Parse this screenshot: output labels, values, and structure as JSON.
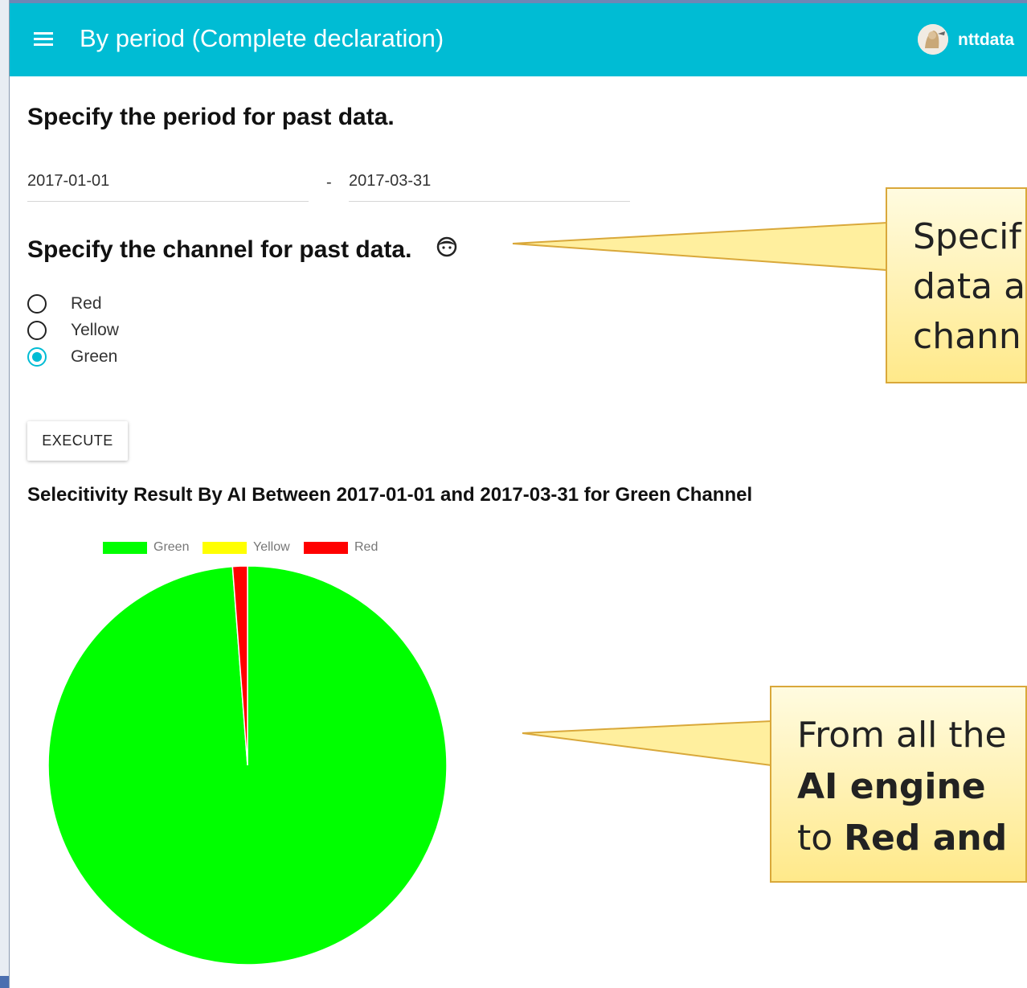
{
  "appbar": {
    "title": "By period (Complete declaration)",
    "user_name": "nttdata",
    "accent_color": "#00bcd4",
    "menu_icon": "hamburger-menu-icon",
    "avatar_icon": "user-avatar-icon"
  },
  "period_section": {
    "heading": "Specify the period for past data.",
    "date_from": "2017-01-01",
    "separator": "-",
    "date_to": "2017-03-31"
  },
  "channel_section": {
    "heading": "Specify the channel for past data.",
    "help_icon": "face-icon",
    "options": [
      {
        "label": "Red",
        "checked": false
      },
      {
        "label": "Yellow",
        "checked": false
      },
      {
        "label": "Green",
        "checked": true
      }
    ]
  },
  "execute_label": "EXECUTE",
  "result_heading": "Selecitivity Result By AI Between 2017-01-01 and 2017-03-31 for Green Channel",
  "chart_data": {
    "type": "pie",
    "title": "",
    "legend_position": "top",
    "categories": [
      "Green",
      "Yellow",
      "Red"
    ],
    "values": [
      98.8,
      0,
      1.2
    ],
    "colors": [
      "#00ff00",
      "#ffff00",
      "#ff0000"
    ]
  },
  "callouts": [
    {
      "lines": [
        [
          {
            "text": "Specif",
            "bold": false
          }
        ],
        [
          {
            "text": "data a",
            "bold": false
          }
        ],
        [
          {
            "text": "chann",
            "bold": false
          }
        ]
      ]
    },
    {
      "lines": [
        [
          {
            "text": "From all the",
            "bold": false
          }
        ],
        [
          {
            "text": "AI engine",
            "bold": true
          }
        ],
        [
          {
            "text": "to ",
            "bold": false
          },
          {
            "text": "Red and",
            "bold": true
          }
        ]
      ]
    }
  ]
}
